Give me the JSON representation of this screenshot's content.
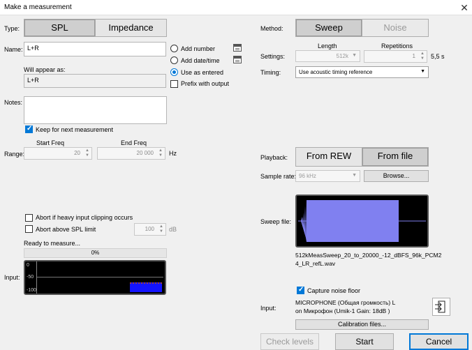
{
  "window": {
    "title": "Make a measurement",
    "close_glyph": "✕"
  },
  "left": {
    "type_label": "Type:",
    "type_options": [
      "SPL",
      "Impedance"
    ],
    "name_label": "Name:",
    "name_value": "L+R",
    "name_options": [
      "Add number",
      "Add date/time",
      "Use as entered",
      "Prefix with output"
    ],
    "appear_label": "Will appear as:",
    "appear_value": "L+R",
    "notes_label": "Notes:",
    "keep_label": "Keep for next measurement",
    "start_freq_label": "Start Freq",
    "end_freq_label": "End Freq",
    "range_label": "Range:",
    "start_freq_value": "20",
    "end_freq_value": "20 000",
    "hz_label": "Hz",
    "abort_clip_label": "Abort if heavy input clipping occurs",
    "abort_spl_label": "Abort above SPL limit",
    "spl_limit_value": "100",
    "db_label": "dB",
    "status_text": "Ready to measure...",
    "progress_text": "0%",
    "progress": 0,
    "input_label": "Input:",
    "meter_ticks": [
      "0",
      "-50",
      "-100"
    ]
  },
  "right": {
    "method_label": "Method:",
    "method_options": [
      "Sweep",
      "Noise"
    ],
    "length_header": "Length",
    "repetitions_header": "Repetitions",
    "settings_label": "Settings:",
    "length_value": "512k",
    "repetitions_value": "1",
    "duration_text": "5,5 s",
    "timing_label": "Timing:",
    "timing_value": "Use acoustic timing reference",
    "playback_label": "Playback:",
    "playback_options": [
      "From REW",
      "From file"
    ],
    "sample_rate_label": "Sample rate:",
    "sample_rate_value": "96 kHz",
    "browse_label": "Browse...",
    "sweep_file_label": "Sweep file:",
    "sweep_filename": "512kMeasSweep_20_to_20000_-12_dBFS_96k_PCM24_LR_refL.wav",
    "capture_noise_label": "Capture noise floor",
    "input_label": "Input:",
    "input_device": "MICROPHONE (Общая громкость) L on Микрофон (Umik-1  Gain: 18dB  )",
    "calibration_label": "Calibration files..."
  },
  "footer": {
    "check_levels": "Check levels",
    "start": "Start",
    "cancel": "Cancel"
  },
  "colors": {
    "accent": "#0078d7",
    "meter_fill": "#1414ff",
    "wave": "#8080f0"
  }
}
